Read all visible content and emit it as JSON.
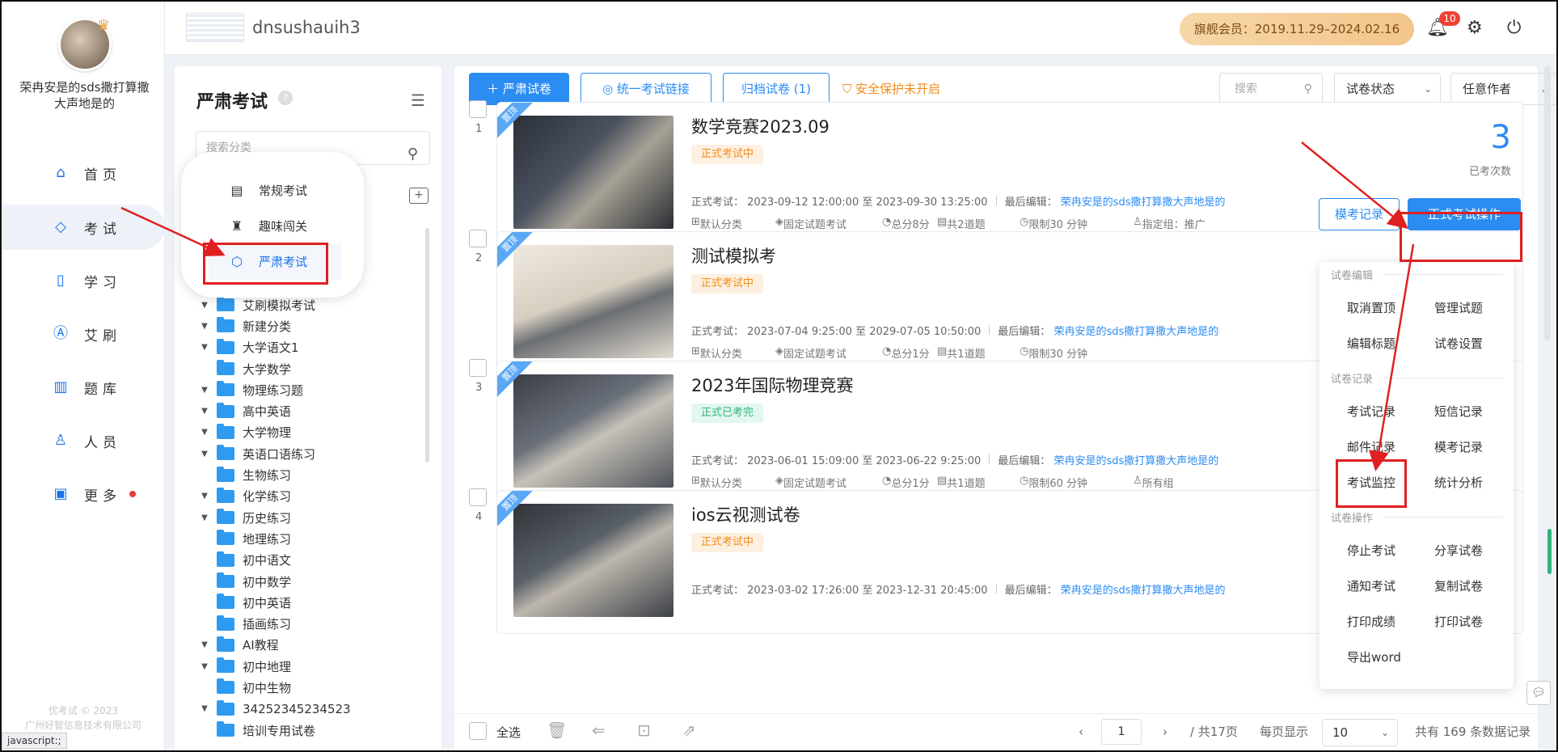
{
  "user": {
    "name": "荣冉安是的sds撒打算撒大声地是的"
  },
  "nav": [
    {
      "label": "首页",
      "icon": "home-icon",
      "glyph": "⌂"
    },
    {
      "label": "考试",
      "icon": "exam-icon",
      "glyph": "◇"
    },
    {
      "label": "学习",
      "icon": "book-icon",
      "glyph": "▯"
    },
    {
      "label": "艾刷",
      "icon": "a-icon",
      "glyph": "Ⓐ"
    },
    {
      "label": "题库",
      "icon": "bar-chart-icon",
      "glyph": "▥"
    },
    {
      "label": "人员",
      "icon": "user-icon",
      "glyph": "♙"
    },
    {
      "label": "更多",
      "icon": "apps-icon",
      "glyph": "▣"
    }
  ],
  "copyright": {
    "line1": "优考试 © 2023",
    "line2": "广州好智信息技术有限公司"
  },
  "status_url": "javascript:;",
  "topbar": {
    "app_name": "dnsushauih3",
    "vip": "旗舰会员：2019.11.29–2024.02.16",
    "notifications": "10"
  },
  "categories": {
    "title": "严肃考试",
    "search_placeholder": "搜索分类",
    "type_menu": [
      {
        "label": "常规考试",
        "icon": "document-icon",
        "glyph": "▤"
      },
      {
        "label": "趣味闯关",
        "icon": "trophy-icon",
        "glyph": "♜"
      },
      {
        "label": "严肃考试",
        "icon": "shield-icon",
        "glyph": "⬡"
      }
    ],
    "tree": [
      {
        "label": "艾刷模拟考试",
        "expand": true
      },
      {
        "label": "新建分类",
        "expand": true
      },
      {
        "label": "大学语文1",
        "expand": true
      },
      {
        "label": "大学数学",
        "expand": false
      },
      {
        "label": "物理练习题",
        "expand": true
      },
      {
        "label": "高中英语",
        "expand": true
      },
      {
        "label": "大学物理",
        "expand": true
      },
      {
        "label": "英语口语练习",
        "expand": true
      },
      {
        "label": "生物练习",
        "expand": false
      },
      {
        "label": "化学练习",
        "expand": true
      },
      {
        "label": "历史练习",
        "expand": true
      },
      {
        "label": "地理练习",
        "expand": false
      },
      {
        "label": "初中语文",
        "expand": false
      },
      {
        "label": "初中数学",
        "expand": false
      },
      {
        "label": "初中英语",
        "expand": false
      },
      {
        "label": "插画练习",
        "expand": false
      },
      {
        "label": "AI教程",
        "expand": true
      },
      {
        "label": "初中地理",
        "expand": true
      },
      {
        "label": "初中生物",
        "expand": false
      },
      {
        "label": "34252345234523",
        "expand": true
      },
      {
        "label": "培训专用试卷",
        "expand": false
      }
    ]
  },
  "toolbar": {
    "new_paper": "＋ 严肃试卷",
    "unified_link": "统一考试链接",
    "archived": "归档试卷 (1)",
    "security": "安全保护未开启",
    "search_placeholder": "搜索",
    "status_select": "试卷状态",
    "author_select": "任意作者"
  },
  "exams": [
    {
      "index": "1",
      "pin": "置顶",
      "title": "数学竞赛2023.09",
      "status": "正式考试中",
      "status_color": "orange",
      "exam_label": "正式考试：",
      "time": "2023-09-12 12:00:00 至 2023-09-30 13:25:00",
      "edit_label": "最后编辑：",
      "editor": "荣冉安是的sds撒打算撒大声地是的",
      "category": "默认分类",
      "mode": "固定试题考试",
      "score": "总分8分",
      "count": "共2道题",
      "limit": "限制30 分钟",
      "group": "指定组：推广",
      "taken": "3",
      "taken_label": "已考次数",
      "mock_btn": "模考记录",
      "op_btn": "正式考试操作"
    },
    {
      "index": "2",
      "pin": "置顶",
      "title": "测试模拟考",
      "status": "正式考试中",
      "status_color": "orange",
      "exam_label": "正式考试：",
      "time": "2023-07-04 9:25:00 至 2029-07-05 10:50:00",
      "edit_label": "最后编辑：",
      "editor": "荣冉安是的sds撒打算撒大声地是的",
      "category": "默认分类",
      "mode": "固定试题考试",
      "score": "总分1分",
      "count": "共1道题",
      "limit": "限制30 分钟",
      "group": ""
    },
    {
      "index": "3",
      "pin": "置顶",
      "title": "2023年国际物理竞赛",
      "status": "正式已考完",
      "status_color": "green",
      "exam_label": "正式考试：",
      "time": "2023-06-01 15:09:00 至 2023-06-22 9:25:00",
      "edit_label": "最后编辑：",
      "editor": "荣冉安是的sds撒打算撒大声地是的",
      "category": "默认分类",
      "mode": "固定试题考试",
      "score": "总分1分",
      "count": "共1道题",
      "limit": "限制60 分钟",
      "group": "所有组"
    },
    {
      "index": "4",
      "pin": "置顶",
      "title": "ios云视测试卷",
      "status": "正式考试中",
      "status_color": "orange",
      "exam_label": "正式考试：",
      "time": "2023-03-02 17:26:00 至 2023-12-31 20:45:00",
      "edit_label": "最后编辑：",
      "editor": "荣冉安是的sds撒打算撒大声地是的",
      "category": "",
      "mode": "",
      "score": "",
      "count": "",
      "limit": "",
      "group": ""
    }
  ],
  "ops_menu": {
    "sec_edit": "试卷编辑",
    "cancel_pin": "取消置顶",
    "manage_questions": "管理试题",
    "edit_title": "编辑标题",
    "paper_settings": "试卷设置",
    "sec_records": "试卷记录",
    "exam_records": "考试记录",
    "sms_records": "短信记录",
    "mail_records": "邮件记录",
    "mock_records": "模考记录",
    "exam_monitor": "考试监控",
    "stats": "统计分析",
    "sec_ops": "试卷操作",
    "stop_exam": "停止考试",
    "share_paper": "分享试卷",
    "notify_exam": "通知考试",
    "copy_paper": "复制试卷",
    "print_scores": "打印成绩",
    "print_paper": "打印试卷",
    "export_word": "导出word"
  },
  "footer": {
    "select_all": "全选",
    "page": "1",
    "total_pages": "/ 共17页",
    "per_page_label": "每页显示",
    "per_page": "10",
    "total_records": "共有 169 条数据记录"
  }
}
